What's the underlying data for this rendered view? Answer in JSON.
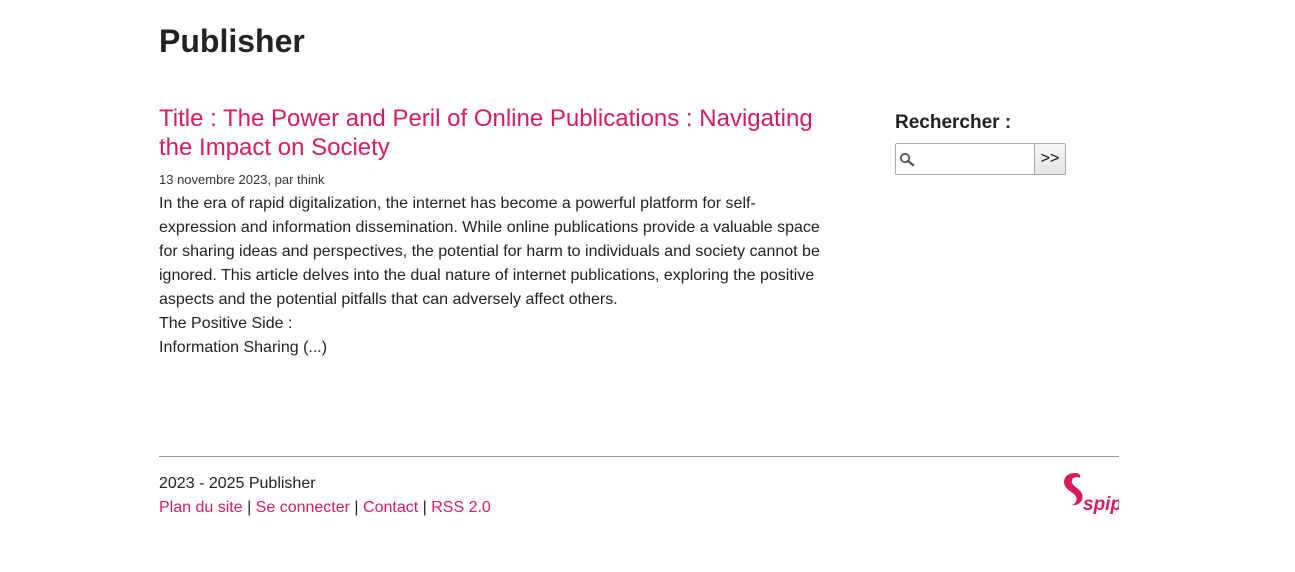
{
  "site": {
    "title": "Publisher"
  },
  "article": {
    "title": "Title : The Power and Peril of Online Publications : Navigating the Impact on Society",
    "meta": "13 novembre 2023, par think",
    "paragraphs": [
      "In the era of rapid digitalization, the internet has become a powerful platform for self-expression and information dissemination. While online publications provide a valuable space for sharing ideas and perspectives, the potential for harm to individuals and society cannot be ignored. This article delves into the dual nature of internet publications, exploring the positive aspects and the potential pitfalls that can adversely affect others.",
      "The Positive Side :",
      "Information Sharing (...)"
    ]
  },
  "search": {
    "label": "Rechercher :",
    "value": "",
    "button_label": ">>"
  },
  "footer": {
    "copyright": "2023 - 2025 Publisher",
    "links": [
      "Plan du site",
      "Se connecter",
      "Contact",
      "RSS 2.0"
    ],
    "separator": "|",
    "logo_text": "spip"
  },
  "colors": {
    "accent": "#d81b60",
    "text": "#222222",
    "rule": "#999999"
  },
  "icons": {
    "search": "magnifier-icon",
    "logo": "spip-logo-icon"
  }
}
